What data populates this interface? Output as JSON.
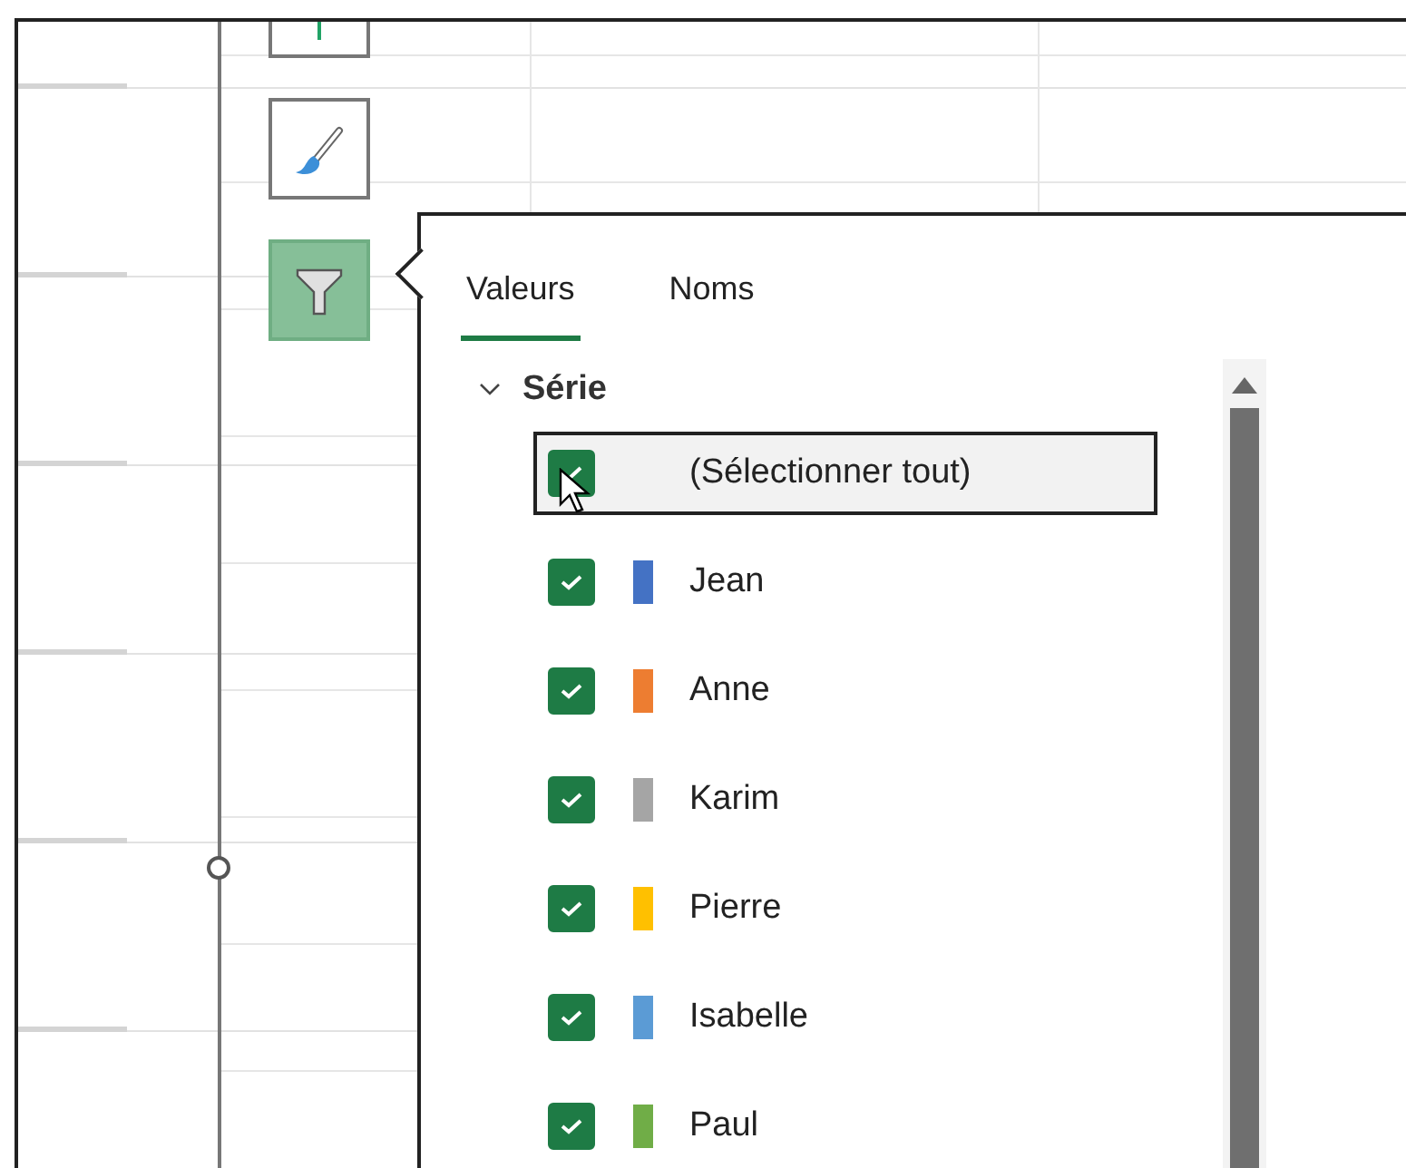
{
  "chart_buttons": [
    {
      "kind": "elements",
      "selected": false
    },
    {
      "kind": "styles",
      "selected": false
    },
    {
      "kind": "filter",
      "selected": true
    }
  ],
  "filter_panel": {
    "tabs": [
      {
        "label": "Valeurs",
        "selected": true
      },
      {
        "label": "Noms",
        "selected": false
      }
    ],
    "group": {
      "label": "Série",
      "expanded": true,
      "children": [
        {
          "label": "(Sélectionner tout)",
          "checked": true,
          "focused": true
        },
        {
          "label": "Jean",
          "checked": true,
          "focused": false,
          "color": "#4472c4"
        },
        {
          "label": "Anne",
          "checked": true,
          "focused": false,
          "color": "#ed7d31"
        },
        {
          "label": "Karim",
          "checked": true,
          "focused": false,
          "color": "#a5a5a5"
        },
        {
          "label": "Pierre",
          "checked": true,
          "focused": false,
          "color": "#ffc000"
        },
        {
          "label": "Isabelle",
          "checked": true,
          "focused": false,
          "color": "#5b9bd5"
        },
        {
          "label": "Paul",
          "checked": true,
          "focused": false,
          "color": "#70ad47"
        }
      ]
    }
  }
}
